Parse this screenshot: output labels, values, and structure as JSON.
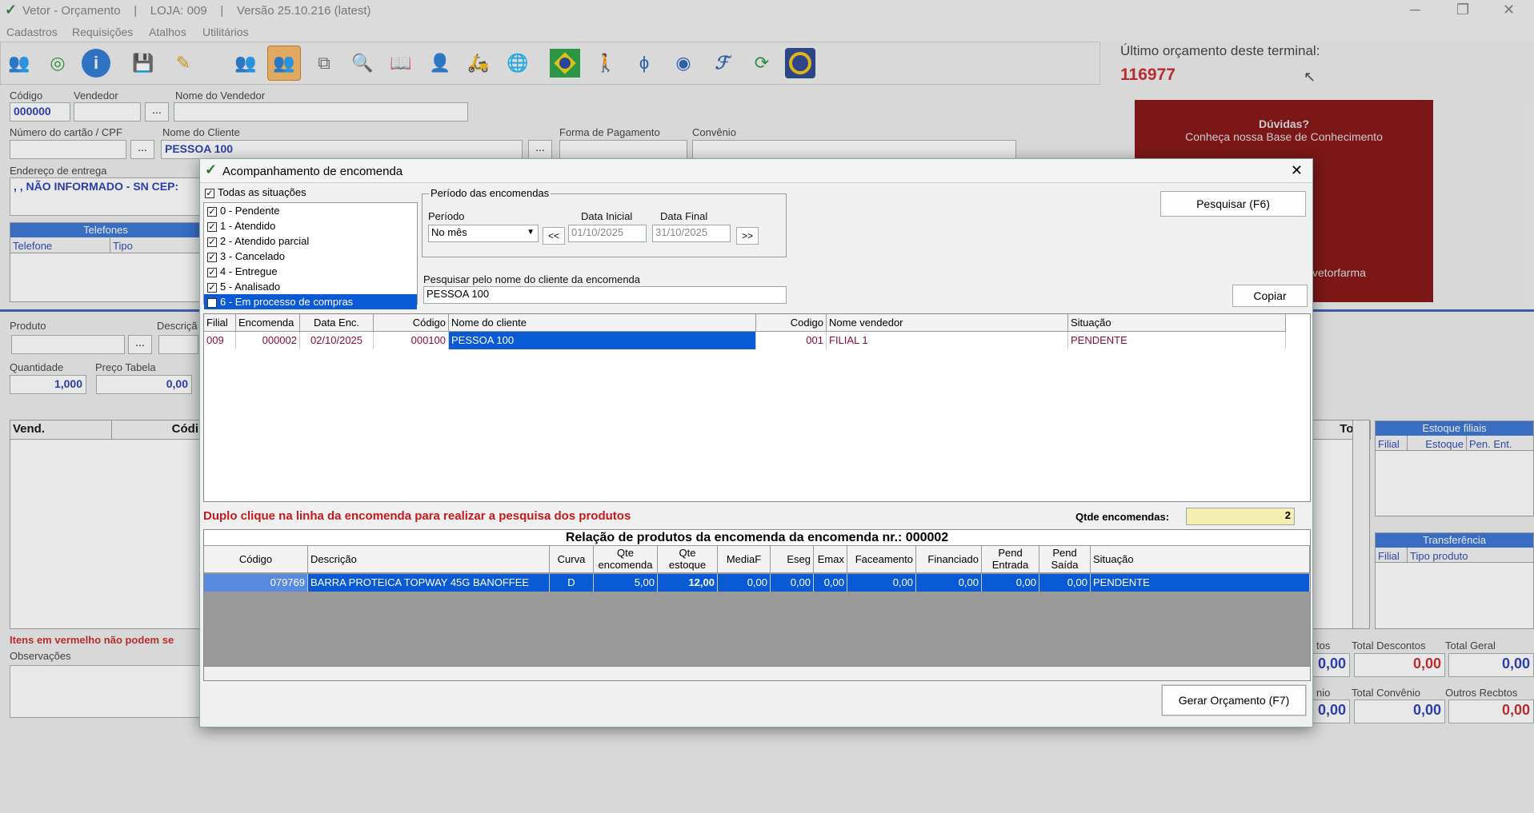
{
  "window": {
    "title": "Vetor - Orçamento    |    LOJA: 009    |    Versão 25.10.216 (latest)",
    "controls": [
      "─",
      "❐",
      "✕"
    ]
  },
  "menu": [
    "Cadastros",
    "Requisições",
    "Atalhos",
    "Utilitários"
  ],
  "toolbar_icons": [
    "clientes-icon",
    "sync-icon",
    "info-icon",
    "save-icon",
    "edit-icon",
    "users-icon",
    "users-selected-icon",
    "copy-icon",
    "search-icon",
    "book-icon",
    "person-icon",
    "delivery-icon",
    "globe-icon",
    "brazil-flag-icon",
    "walk-icon",
    "antenna-icon",
    "spiral-icon",
    "f-icon",
    "refresh-icon",
    "ring-icon"
  ],
  "last_budget": {
    "label": "Último orçamento deste terminal:",
    "value": "116977"
  },
  "help_banner": {
    "title": "Dúvidas?",
    "subtitle": "Conheça nossa Base de Conhecimento",
    "footer": "vetorfarma"
  },
  "form": {
    "codigo_label": "Código",
    "codigo": "000000",
    "vendedor_label": "Vendedor",
    "nome_vendedor_label": "Nome do Vendedor",
    "cartao_label": "Número do cartão / CPF",
    "cliente_label": "Nome do Cliente",
    "cliente": "PESSOA 100",
    "forma_pag_label": "Forma de Pagamento",
    "convenio_label": "Convênio",
    "endereco_label": "Endereço de entrega",
    "endereco": ", , NÃO INFORMADO - SN CEP:",
    "telefones_title": "Telefones",
    "telefone_col": "Telefone",
    "tipo_col": "Tipo",
    "produto_label": "Produto",
    "descricao_label": "Descriçã",
    "quantidade_label": "Quantidade",
    "quantidade": "1,000",
    "preco_label": "Preço Tabela",
    "preco": "0,00",
    "vend_col": "Vend.",
    "cod_col": "Códi",
    "total_col": "Total",
    "itens_warning": "Itens em vermelho não podem se",
    "obs_label": "Observações",
    "estoque_title": "Estoque filiais",
    "estoque_cols": [
      "Filial",
      "Estoque",
      "Pen. Ent."
    ],
    "transf_title": "Transferência",
    "transf_cols": [
      "Filial",
      "Tipo produto"
    ],
    "totals": [
      {
        "label": "tos",
        "value": "0,00"
      },
      {
        "label": "Total Descontos",
        "value": "0,00"
      },
      {
        "label": "Total Geral",
        "value": "0,00"
      },
      {
        "label": "nio",
        "value": "0,00"
      },
      {
        "label": "Total Convênio",
        "value": "0,00"
      },
      {
        "label": "Outros Recbtos",
        "value": "0,00"
      }
    ],
    "ellipsis": "..."
  },
  "dialog": {
    "title": "Acompanhamento de encomenda",
    "close": "✕",
    "todas_label": "Todas as situações",
    "situacoes": [
      "0 - Pendente",
      "1 - Atendido",
      "2 - Atendido parcial",
      "3 - Cancelado",
      "4 - Entregue",
      "5 - Analisado",
      "6 - Em processo de compras"
    ],
    "periodo_group": "Período das encomendas",
    "periodo_label": "Período",
    "periodo_value": "No mês",
    "data_inicial_label": "Data Inicial",
    "data_inicial": "01/10/2025",
    "data_final_label": "Data Final",
    "data_final": "31/10/2025",
    "prev": "<<",
    "next": ">>",
    "pesquisar_btn": "Pesquisar (F6)",
    "copiar_btn": "Copiar",
    "search_label": "Pesquisar pelo nome do cliente da encomenda",
    "search_value": "PESSOA 100",
    "orders_cols": [
      "Filial",
      "Encomenda",
      "Data Enc.",
      "Código",
      "Nome do cliente",
      "Codigo",
      "Nome vendedor",
      "Situação"
    ],
    "orders_rows": [
      [
        "009",
        "000002",
        "02/10/2025",
        "000100",
        "PESSOA 100",
        "001",
        "FILIAL 1",
        "PENDENTE"
      ]
    ],
    "hint": "Duplo clique na linha da encomenda para realizar a  pesquisa dos produtos",
    "qtde_label": "Qtde encomendas:",
    "qtde": "2",
    "products_title": "Relação de produtos da encomenda da encomenda nr.: 000002",
    "products_cols": [
      "Código",
      "Descrição",
      "Curva",
      "Qte encomenda",
      "Qte estoque",
      "MediaF",
      "Eseg",
      "Emax",
      "Faceamento",
      "Financiado",
      "Pend Entrada",
      "Pend Saída",
      "Situação"
    ],
    "products_rows": [
      [
        "079769",
        "BARRA PROTEICA TOPWAY 45G BANOFFEE",
        "D",
        "5,00",
        "12,00",
        "0,00",
        "0,00",
        "0,00",
        "0,00",
        "0,00",
        "0,00",
        "0,00",
        "PENDENTE"
      ]
    ],
    "gerar_btn": "Gerar Orçamento (F7)"
  }
}
